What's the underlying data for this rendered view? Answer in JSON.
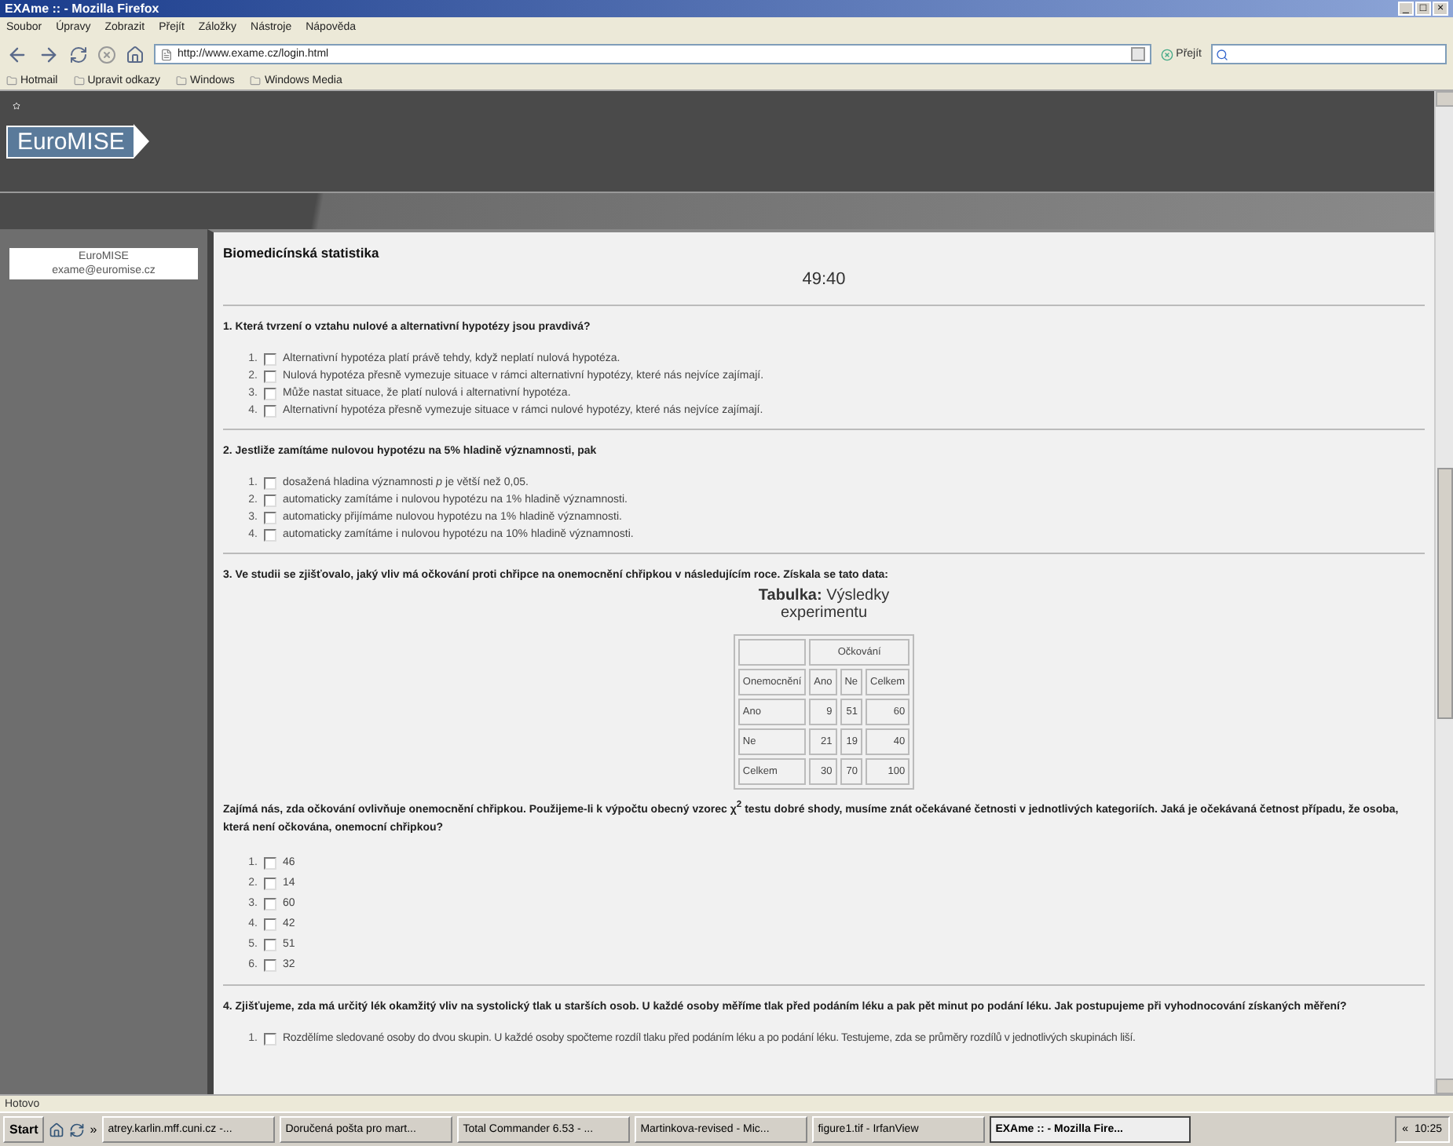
{
  "window": {
    "title": "EXAme :: - Mozilla Firefox",
    "controls": [
      "_",
      "□",
      "×"
    ]
  },
  "menu": [
    "Soubor",
    "Úpravy",
    "Zobrazit",
    "Přejít",
    "Záložky",
    "Nástroje",
    "Nápověda"
  ],
  "toolbar": {
    "url": "http://www.exame.cz/login.html",
    "go": "Přejít"
  },
  "bookmarks": [
    "Hotmail",
    "Upravit odkazy",
    "Windows",
    "Windows Media"
  ],
  "site": {
    "logo": "EuroMISE"
  },
  "sidebar": {
    "name": "EuroMISE",
    "email": "exame@euromise.cz"
  },
  "course": "Biomedicínská statistika",
  "timer": "49:40",
  "questions": [
    {
      "text": "1. Která tvrzení o vztahu nulové a alternativní hypotézy jsou pravdivá?",
      "options": [
        {
          "number": "1.",
          "label": "Alternativní hypotéza platí právě tehdy, když neplatí nulová hypotéza.",
          "checked": false
        },
        {
          "number": "2.",
          "label": "Nulová hypotéza přesně vymezuje situace v rámci alternativní hypotézy, které nás nejvíce zajímají.",
          "checked": false
        },
        {
          "number": "3.",
          "label": "Může nastat situace, že platí nulová i alternativní hypotéza.",
          "checked": false
        },
        {
          "number": "4.",
          "label": "Alternativní hypotéza přesně vymezuje situace v rámci nulové hypotézy, které nás nejvíce zajímají.",
          "checked": false
        }
      ]
    },
    {
      "text": "2. Jestliže zamítáme nulovou hypotézu na 5% hladině významnosti, pak",
      "options": [
        {
          "number": "1.",
          "label": "dosažená hladina významnosti *p* je větší než 0,05.",
          "checked": false
        },
        {
          "number": "2.",
          "label": "automaticky zamítáme i nulovou hypotézu na 1% hladině významnosti.",
          "checked": false
        },
        {
          "number": "3.",
          "label": "automaticky přijímáme nulovou hypotézu na 1% hladině významnosti.",
          "checked": false
        },
        {
          "number": "4.",
          "label": "automaticky zamítáme i nulovou hypotézu na 10% hladině významnosti.",
          "checked": false
        }
      ]
    },
    {
      "text": "3. Ve studii se zjišťovalo, jaký vliv má očkování proti chřipce na onemocnění chřipkou v následujícím roce. Získala se tato data:",
      "table": {
        "caption": "**Tabulka:** Výsledky experimentu",
        "group_header": "Očkování",
        "columns": [
          "Onemocnění",
          "Ano",
          "Ne",
          "Celkem"
        ],
        "rows": [
          [
            "Ano",
            "9",
            "51",
            "60"
          ],
          [
            "Ne",
            "21",
            "19",
            "40"
          ],
          [
            "Celkem",
            "30",
            "70",
            "100"
          ]
        ]
      },
      "followup": "Zajímá nás, zda očkování ovlivňuje onemocnění chřipkou. Použijeme-li k výpočtu obecný vzorec χ$^{2}$ testu dobré shody, musíme znát očekávané četnosti v jednotlivých kategoriích. Jaká je očekávaná četnost případu, že osoba, která není očkována, onemocní chřipkou?",
      "options": [
        {
          "number": "1.",
          "label": "46",
          "checked": false
        },
        {
          "number": "2.",
          "label": "14",
          "checked": false
        },
        {
          "number": "3.",
          "label": "60",
          "checked": false
        },
        {
          "number": "4.",
          "label": "42",
          "checked": false
        },
        {
          "number": "5.",
          "label": "51",
          "checked": false
        },
        {
          "number": "6.",
          "label": "32",
          "checked": false
        }
      ]
    },
    {
      "text": "4. Zjišťujeme, zda má určitý lék okamžitý vliv na systolický tlak u starších osob. U každé osoby měříme tlak před podáním léku a pak pět minut po podání léku. Jak postupujeme při vyhodnocování získaných měření?",
      "options": [
        {
          "number": "1.",
          "label": "Rozdělíme sledované osoby do dvou skupin. U každé osoby spočteme rozdíl tlaku před podáním léku a po podání léku. Testujeme, zda se průměry rozdílů v jednotlivých skupinách liší.",
          "checked": false
        }
      ]
    }
  ],
  "status": "Hotovo",
  "taskbar": {
    "start": "Start",
    "more": "»",
    "items": [
      {
        "label": "atrey.karlin.mff.cuni.cz -...",
        "selected": false
      },
      {
        "label": "Doručená pošta pro mart...",
        "selected": false
      },
      {
        "label": "Total Commander 6.53 - ...",
        "selected": false
      },
      {
        "label": "Martinkova-revised - Mic...",
        "selected": false
      },
      {
        "label": "figure1.tif - IrfanView",
        "selected": false
      },
      {
        "label": "EXAme :: - Mozilla Fire...",
        "selected": true
      }
    ],
    "tray": "«",
    "clock": "10:25"
  }
}
